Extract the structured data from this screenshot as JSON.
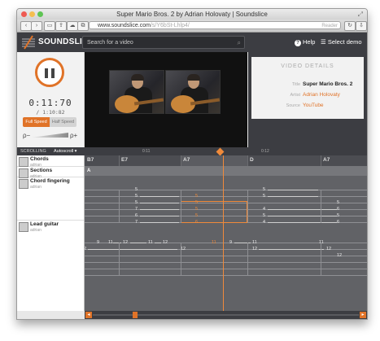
{
  "browser": {
    "title": "Super Mario Bros. 2 by Adrian Holovaty | Soundslice",
    "url_host": "www.soundslice.com",
    "url_path": "/s/Y6bSt-Lhlp4/",
    "reader_label": "Reader"
  },
  "header": {
    "logo_text": "SOUNDSLICE",
    "search_placeholder": "Search for a video",
    "help_label": "Help",
    "demo_label": "Select demo"
  },
  "player": {
    "current_time": "0:11:70",
    "duration": "/ 1:10:82",
    "full_speed": "Full Speed",
    "half_speed": "Half Speed",
    "zoom_out": "ρ−",
    "zoom_in": "ρ+"
  },
  "details": {
    "heading": "VIDEO DETAILS",
    "title_key": "Title",
    "title_val": "Super Mario Bros. 2",
    "artist_key": "Artist",
    "artist_val": "Adrian Holovaty",
    "source_key": "Source",
    "source_val": "YouTube"
  },
  "timeline": {
    "scrolling_label": "SCROLLING",
    "autoscroll_label": "Autoscroll ▾",
    "tick_1": "0:11",
    "tick_2": "0:12"
  },
  "tracks": [
    {
      "name": "Chords",
      "owner": "adrian"
    },
    {
      "name": "Sections",
      "owner": "adrian"
    },
    {
      "name": "Chord fingering",
      "owner": "adrian"
    },
    {
      "name": "Lead guitar",
      "owner": "adrian"
    }
  ],
  "chords": [
    "B7",
    "E7",
    "A7",
    "D",
    "A7"
  ],
  "section": "A",
  "fingering": {
    "col1": [
      "5",
      "5",
      "7",
      "6",
      "7",
      "5"
    ],
    "col_hl": [
      "5",
      "5",
      "5",
      "6",
      "5"
    ],
    "col2": [
      "5",
      "5",
      "4",
      "5",
      "4"
    ],
    "col3": [
      "5",
      "6",
      "5",
      "6"
    ]
  },
  "lead": {
    "row1": [
      "9",
      "11",
      "12",
      "11",
      "12",
      "11",
      "9",
      "11",
      "11"
    ],
    "row2": [
      "12",
      "12",
      "12"
    ],
    "row3": [
      "12"
    ],
    "left_fret": "2"
  },
  "colors": {
    "accent": "#e07328",
    "header_bg": "#3c3d42"
  }
}
